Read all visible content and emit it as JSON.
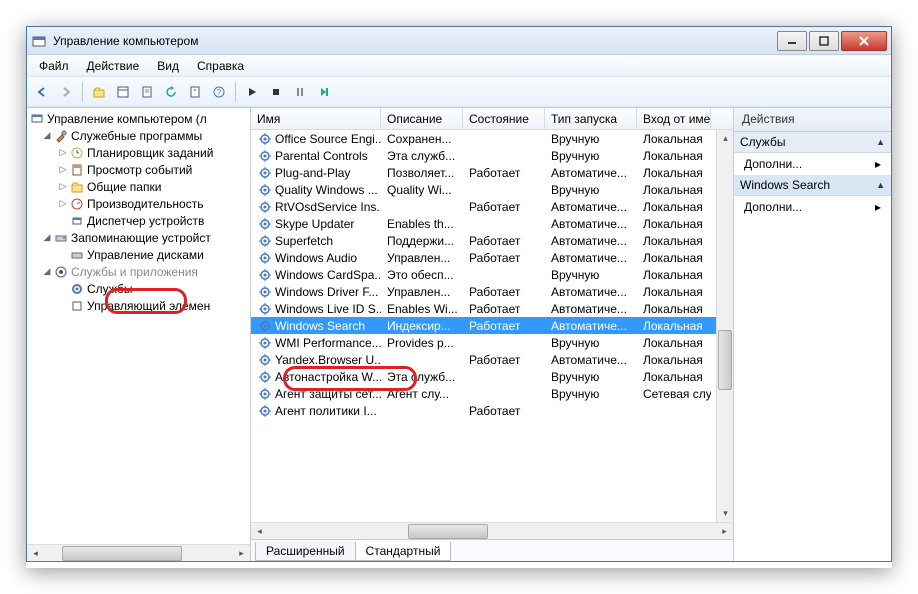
{
  "window": {
    "title": "Управление компьютером"
  },
  "menu": {
    "file": "Файл",
    "action": "Действие",
    "view": "Вид",
    "help": "Справка"
  },
  "tree": {
    "root": "Управление компьютером (л",
    "sys_tools": "Служебные программы",
    "scheduler": "Планировщик заданий",
    "eventvwr": "Просмотр событий",
    "shared": "Общие папки",
    "perf": "Производительность",
    "devmgr": "Диспетчер устройств",
    "storage": "Запоминающие устройст",
    "diskmgmt": "Управление дисками",
    "servapps": "Службы и приложения",
    "services": "Службы",
    "wmi": "Управляющий элемен"
  },
  "columns": {
    "name": "Имя",
    "desc": "Описание",
    "state": "Состояние",
    "start": "Тип запуска",
    "logon": "Вход от име"
  },
  "services": [
    {
      "name": "Office Source Engi...",
      "desc": "Сохранен...",
      "state": "",
      "start": "Вручную",
      "logon": "Локальная"
    },
    {
      "name": "Parental Controls",
      "desc": "Эта служб...",
      "state": "",
      "start": "Вручную",
      "logon": "Локальная"
    },
    {
      "name": "Plug-and-Play",
      "desc": "Позволяет...",
      "state": "Работает",
      "start": "Автоматиче...",
      "logon": "Локальная"
    },
    {
      "name": "Quality Windows ...",
      "desc": "Quality Wi...",
      "state": "",
      "start": "Вручную",
      "logon": "Локальная"
    },
    {
      "name": "RtVOsdService Ins...",
      "desc": "",
      "state": "Работает",
      "start": "Автоматиче...",
      "logon": "Локальная"
    },
    {
      "name": "Skype Updater",
      "desc": "Enables th...",
      "state": "",
      "start": "Автоматиче...",
      "logon": "Локальная"
    },
    {
      "name": "Superfetch",
      "desc": "Поддержи...",
      "state": "Работает",
      "start": "Автоматиче...",
      "logon": "Локальная"
    },
    {
      "name": "Windows Audio",
      "desc": "Управлен...",
      "state": "Работает",
      "start": "Автоматиче...",
      "logon": "Локальная"
    },
    {
      "name": "Windows CardSpa...",
      "desc": "Это обесп...",
      "state": "",
      "start": "Вручную",
      "logon": "Локальная"
    },
    {
      "name": "Windows Driver F...",
      "desc": "Управлен...",
      "state": "Работает",
      "start": "Автоматиче...",
      "logon": "Локальная"
    },
    {
      "name": "Windows Live ID S...",
      "desc": "Enables Wi...",
      "state": "Работает",
      "start": "Автоматиче...",
      "logon": "Локальная"
    },
    {
      "name": "Windows Search",
      "desc": "Индексир...",
      "state": "Работает",
      "start": "Автоматиче...",
      "logon": "Локальная",
      "selected": true
    },
    {
      "name": "WMI Performance...",
      "desc": "Provides p...",
      "state": "",
      "start": "Вручную",
      "logon": "Локальная"
    },
    {
      "name": "Yandex.Browser U...",
      "desc": "",
      "state": "Работает",
      "start": "Автоматиче...",
      "logon": "Локальная"
    },
    {
      "name": "Автонастройка W...",
      "desc": "Эта служб...",
      "state": "",
      "start": "Вручную",
      "logon": "Локальная"
    },
    {
      "name": "Агент защиты сет...",
      "desc": "Агент слу...",
      "state": "",
      "start": "Вручную",
      "logon": "Сетевая слу"
    },
    {
      "name": "Агент политики I...",
      "desc": "",
      "state": "Работает",
      "start": "",
      "logon": ""
    }
  ],
  "tabs": {
    "extended": "Расширенный",
    "standard": "Стандартный"
  },
  "actions": {
    "header": "Действия",
    "section1": "Службы",
    "section2": "Windows Search",
    "more": "Дополни..."
  }
}
